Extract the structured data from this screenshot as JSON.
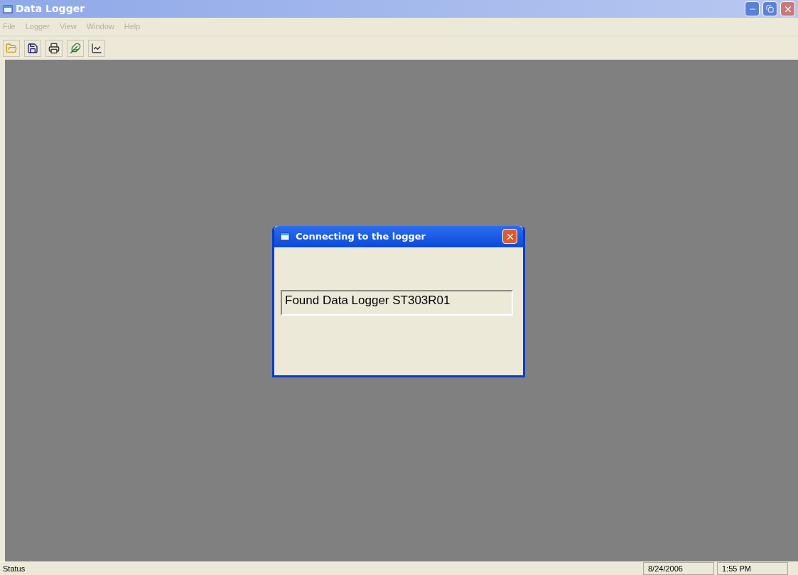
{
  "window": {
    "title": "Data Logger"
  },
  "menu": [
    {
      "label": "File",
      "disabled": true
    },
    {
      "label": "Logger",
      "disabled": true
    },
    {
      "label": "View",
      "disabled": true
    },
    {
      "label": "Window",
      "disabled": true
    },
    {
      "label": "Help",
      "disabled": true
    }
  ],
  "dialog": {
    "title": "Connecting to the logger",
    "message": "Found Data Logger ST303R01"
  },
  "status_bar": {
    "status": "Status",
    "date": "8/24/2006",
    "time": "1:55 PM"
  }
}
